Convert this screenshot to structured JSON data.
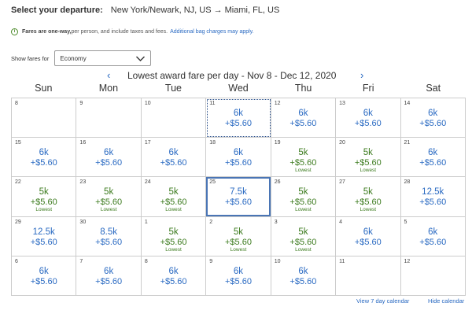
{
  "departure": {
    "label": "Select your departure:",
    "route": "New York/Newark, NJ, US → Miami, FL, US"
  },
  "info": {
    "icon": "info-icon",
    "strong": "Fares are one-way,",
    "text": " per person, and include taxes and fees.",
    "link": "Additional bag charges may apply."
  },
  "fares": {
    "label": "Show fares for",
    "selected": "Economy"
  },
  "nav": {
    "prev": "‹",
    "next": "›",
    "title": "Lowest award fare per day - Nov 8 - Dec 12, 2020"
  },
  "days_of_week": [
    "Sun",
    "Mon",
    "Tue",
    "Wed",
    "Thu",
    "Fri",
    "Sat"
  ],
  "colors": {
    "blue": "#2a6ac2",
    "green": "#3c7b1e"
  },
  "weeks": [
    [
      {
        "day": "8",
        "miles": "",
        "tax": "",
        "lowest": ""
      },
      {
        "day": "9",
        "miles": "",
        "tax": "",
        "lowest": ""
      },
      {
        "day": "10",
        "miles": "",
        "tax": "",
        "lowest": ""
      },
      {
        "day": "11",
        "miles": "6k",
        "tax": "+$5.60",
        "lowest": "",
        "color": "blue",
        "state": "today"
      },
      {
        "day": "12",
        "miles": "6k",
        "tax": "+$5.60",
        "lowest": "",
        "color": "blue"
      },
      {
        "day": "13",
        "miles": "6k",
        "tax": "+$5.60",
        "lowest": "",
        "color": "blue"
      },
      {
        "day": "14",
        "miles": "6k",
        "tax": "+$5.60",
        "lowest": "",
        "color": "blue"
      }
    ],
    [
      {
        "day": "15",
        "miles": "6k",
        "tax": "+$5.60",
        "lowest": "",
        "color": "blue"
      },
      {
        "day": "16",
        "miles": "6k",
        "tax": "+$5.60",
        "lowest": "",
        "color": "blue"
      },
      {
        "day": "17",
        "miles": "6k",
        "tax": "+$5.60",
        "lowest": "",
        "color": "blue"
      },
      {
        "day": "18",
        "miles": "6k",
        "tax": "+$5.60",
        "lowest": "",
        "color": "blue"
      },
      {
        "day": "19",
        "miles": "5k",
        "tax": "+$5.60",
        "lowest": "Lowest",
        "color": "green"
      },
      {
        "day": "20",
        "miles": "5k",
        "tax": "+$5.60",
        "lowest": "Lowest",
        "color": "green"
      },
      {
        "day": "21",
        "miles": "6k",
        "tax": "+$5.60",
        "lowest": "",
        "color": "blue"
      }
    ],
    [
      {
        "day": "22",
        "miles": "5k",
        "tax": "+$5.60",
        "lowest": "Lowest",
        "color": "green"
      },
      {
        "day": "23",
        "miles": "5k",
        "tax": "+$5.60",
        "lowest": "Lowest",
        "color": "green"
      },
      {
        "day": "24",
        "miles": "5k",
        "tax": "+$5.60",
        "lowest": "Lowest",
        "color": "green"
      },
      {
        "day": "25",
        "miles": "7.5k",
        "tax": "+$5.60",
        "lowest": "",
        "color": "blue",
        "state": "selected"
      },
      {
        "day": "26",
        "miles": "5k",
        "tax": "+$5.60",
        "lowest": "Lowest",
        "color": "green"
      },
      {
        "day": "27",
        "miles": "5k",
        "tax": "+$5.60",
        "lowest": "Lowest",
        "color": "green"
      },
      {
        "day": "28",
        "miles": "12.5k",
        "tax": "+$5.60",
        "lowest": "",
        "color": "blue"
      }
    ],
    [
      {
        "day": "29",
        "miles": "12.5k",
        "tax": "+$5.60",
        "lowest": "",
        "color": "blue"
      },
      {
        "day": "30",
        "miles": "8.5k",
        "tax": "+$5.60",
        "lowest": "",
        "color": "blue"
      },
      {
        "day": "1",
        "miles": "5k",
        "tax": "+$5.60",
        "lowest": "Lowest",
        "color": "green"
      },
      {
        "day": "2",
        "miles": "5k",
        "tax": "+$5.60",
        "lowest": "Lowest",
        "color": "green"
      },
      {
        "day": "3",
        "miles": "5k",
        "tax": "+$5.60",
        "lowest": "Lowest",
        "color": "green"
      },
      {
        "day": "4",
        "miles": "6k",
        "tax": "+$5.60",
        "lowest": "",
        "color": "blue"
      },
      {
        "day": "5",
        "miles": "6k",
        "tax": "+$5.60",
        "lowest": "",
        "color": "blue"
      }
    ],
    [
      {
        "day": "6",
        "miles": "6k",
        "tax": "+$5.60",
        "lowest": "",
        "color": "blue"
      },
      {
        "day": "7",
        "miles": "6k",
        "tax": "+$5.60",
        "lowest": "",
        "color": "blue"
      },
      {
        "day": "8",
        "miles": "6k",
        "tax": "+$5.60",
        "lowest": "",
        "color": "blue"
      },
      {
        "day": "9",
        "miles": "6k",
        "tax": "+$5.60",
        "lowest": "",
        "color": "blue"
      },
      {
        "day": "10",
        "miles": "6k",
        "tax": "+$5.60",
        "lowest": "",
        "color": "blue"
      },
      {
        "day": "11",
        "miles": "",
        "tax": "",
        "lowest": ""
      },
      {
        "day": "12",
        "miles": "",
        "tax": "",
        "lowest": ""
      }
    ]
  ],
  "footer": {
    "view7": "View 7 day calendar",
    "hide": "Hide calendar"
  }
}
